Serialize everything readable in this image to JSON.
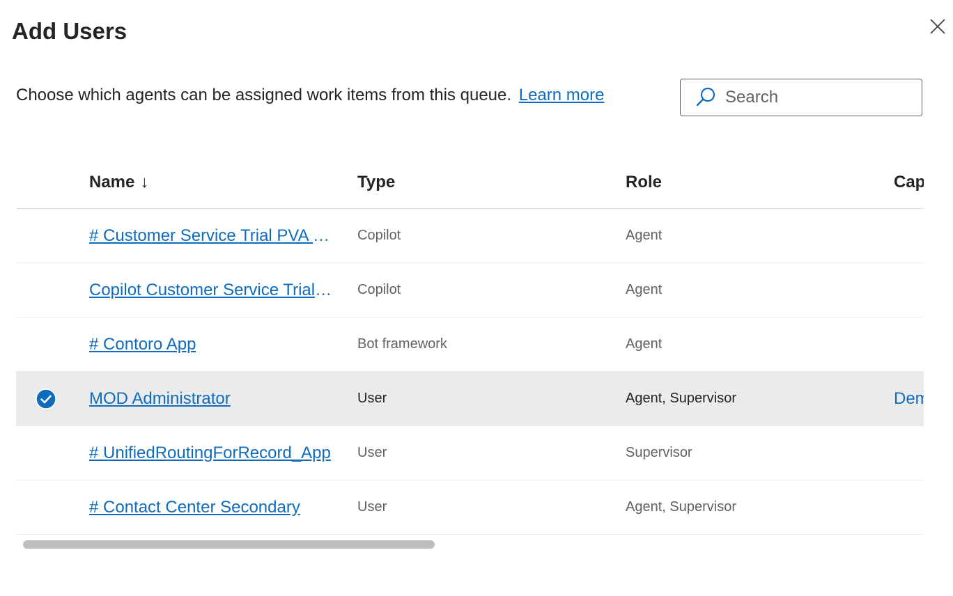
{
  "dialog": {
    "title": "Add Users",
    "description": "Choose which agents can be assigned work items from this queue.",
    "learn_more": "Learn more"
  },
  "search": {
    "placeholder": "Search",
    "value": ""
  },
  "table": {
    "columns": {
      "name": "Name",
      "sort_indicator": "↓",
      "type": "Type",
      "role": "Role",
      "capacity": "Cap"
    },
    "rows": [
      {
        "name": "# Customer Service Trial PVA -…",
        "type": "Copilot",
        "role": "Agent",
        "capacity": "",
        "selected": false
      },
      {
        "name": "Copilot Customer Service Trial …",
        "type": "Copilot",
        "role": "Agent",
        "capacity": "",
        "selected": false
      },
      {
        "name": "# Contoro App",
        "type": "Bot framework",
        "role": "Agent",
        "capacity": "",
        "selected": false
      },
      {
        "name": "MOD Administrator",
        "type": "User",
        "role": "Agent, Supervisor",
        "capacity": "Dem",
        "selected": true
      },
      {
        "name": "# UnifiedRoutingForRecord_App",
        "type": "User",
        "role": "Supervisor",
        "capacity": "",
        "selected": false
      },
      {
        "name": "# Contact Center Secondary",
        "type": "User",
        "role": "Agent, Supervisor",
        "capacity": "",
        "selected": false
      }
    ]
  },
  "colors": {
    "accent": "#0f6cbd",
    "selected_row": "#ebebeb",
    "text": "#242424",
    "muted": "#616161"
  },
  "icons": {
    "close": "close-icon",
    "search": "search-icon",
    "check": "checkmark-circle-icon"
  }
}
